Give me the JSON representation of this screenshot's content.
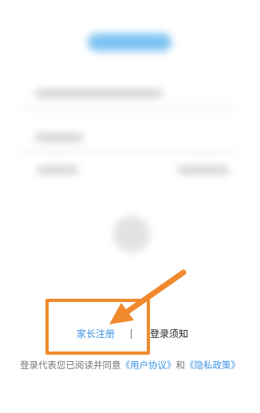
{
  "links": {
    "parent_register": "家长注册",
    "login_notice": "登录须知"
  },
  "agreement": {
    "prefix": "登录代表您已阅读并同意",
    "user_agreement": "《用户协议》",
    "conjunction": "和",
    "privacy_policy": "《隐私政策》"
  },
  "annotation": {
    "color": "#f08a2c"
  },
  "colors": {
    "link_blue": "#3a93e6",
    "accent_pill": "#7cc3f2"
  }
}
